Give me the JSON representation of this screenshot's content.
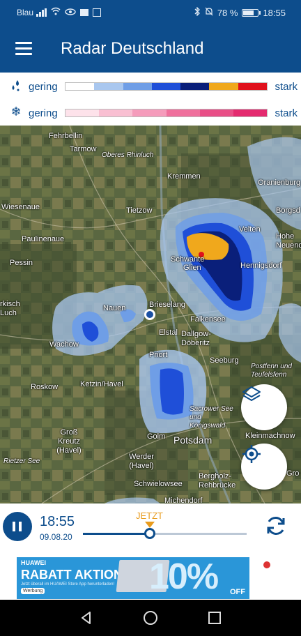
{
  "status_bar": {
    "carrier": "Blau",
    "battery_percent": "78 %",
    "battery_level": 0.78,
    "time": "18:55"
  },
  "app_bar": {
    "title": "Radar Deutschland",
    "menu_icon": "hamburger-menu-icon"
  },
  "legend": {
    "rain": {
      "icon": "raindrops-icon",
      "low_label": "gering",
      "high_label": "stark",
      "colors": [
        "#ffffff",
        "#a9c7ef",
        "#6f9ee6",
        "#1f4fd8",
        "#0a1f7a",
        "#f0a81c",
        "#e0101c"
      ]
    },
    "snow": {
      "icon": "snowflake-icon",
      "low_label": "gering",
      "high_label": "stark",
      "colors": [
        "#fde2ea",
        "#f9bfd2",
        "#f59bbb",
        "#ef6f9c",
        "#e84d86",
        "#e42a6f"
      ]
    }
  },
  "map": {
    "places": [
      {
        "id": "fehrbellin",
        "name": "Fehrbellin"
      },
      {
        "id": "tarmow",
        "name": "Tarmow"
      },
      {
        "id": "oberes-rhinluch",
        "name": "Oberes Rhinluch"
      },
      {
        "id": "kremmen",
        "name": "Kremmen"
      },
      {
        "id": "oranienburg",
        "name": "Oranienburg"
      },
      {
        "id": "wiesenaue",
        "name": "Wiesenaue"
      },
      {
        "id": "tietzow",
        "name": "Tietzow"
      },
      {
        "id": "borgsdorf",
        "name": "Borgsd"
      },
      {
        "id": "veltén",
        "name": "Velten"
      },
      {
        "id": "paulinenaue",
        "name": "Paulinenaue"
      },
      {
        "id": "schwante",
        "name": "Schwante"
      },
      {
        "id": "hohen-neuendorf",
        "name": "Hohe Neuend"
      },
      {
        "id": "pessin",
        "name": "Pessin"
      },
      {
        "id": "glien",
        "name": "Glien"
      },
      {
        "id": "hennigsdorf",
        "name": "Hennigsdorf"
      },
      {
        "id": "nauen",
        "name": "Nauen"
      },
      {
        "id": "brieselang",
        "name": "Brieselang"
      },
      {
        "id": "markisch-luch",
        "name": "rkisch Luch"
      },
      {
        "id": "falkensee",
        "name": "Falkensee"
      },
      {
        "id": "elstal",
        "name": "Elstal"
      },
      {
        "id": "dallgow",
        "name": "Dallgow-Döberitz"
      },
      {
        "id": "wachow",
        "name": "Wachow"
      },
      {
        "id": "priort",
        "name": "Priort"
      },
      {
        "id": "seeburg",
        "name": "Seeburg"
      },
      {
        "id": "postfenn",
        "name": "Postfenn und Teufelsfenn"
      },
      {
        "id": "roskow",
        "name": "Roskow"
      },
      {
        "id": "ketzin",
        "name": "Ketzin/Havel"
      },
      {
        "id": "sacrower-see",
        "name": "Sacrower See und Königswald"
      },
      {
        "id": "gross-kreutz",
        "name": "Groß Kreutz (Havel)"
      },
      {
        "id": "golm",
        "name": "Golm"
      },
      {
        "id": "potsdam",
        "name": "Potsdam"
      },
      {
        "id": "kleinmachnow",
        "name": "Kleinmachnow"
      },
      {
        "id": "rietzer-see",
        "name": "Rietzer See"
      },
      {
        "id": "werder",
        "name": "Werder (Havel)"
      },
      {
        "id": "gross",
        "name": "Gro"
      },
      {
        "id": "schwielowsee",
        "name": "Schwielowsee"
      },
      {
        "id": "bergholz",
        "name": "Bergholz-Rehbrücke"
      },
      {
        "id": "michendorf",
        "name": "Michendorf"
      }
    ],
    "layers_button_icon": "layers-icon",
    "locate_button_icon": "crosshair-location-icon"
  },
  "timeline": {
    "time": "18:55",
    "date": "09.08.20",
    "now_label": "JETZT",
    "position": 0.41,
    "play_icon": "pause-icon",
    "refresh_icon": "refresh-icon"
  },
  "ad": {
    "brand": "HUAWEI",
    "headline": "RABATT AKTION",
    "sub": "Jetzt überall im HUAWEI Store App herunterladen!",
    "percent": "10%",
    "off": "OFF",
    "tag": "Werbung"
  },
  "nav_bar": {
    "back_icon": "back-triangle-icon",
    "home_icon": "home-circle-icon",
    "recents_icon": "recents-square-icon"
  }
}
